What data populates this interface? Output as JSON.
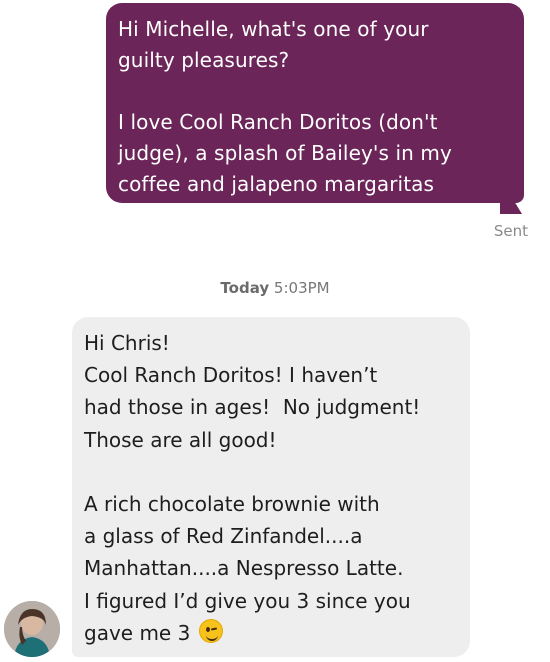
{
  "conversation": {
    "sent_message": {
      "text": "Hi Michelle, what's one of your\nguilty pleasures?\n\nI love Cool Ranch Doritos (don't\njudge), a splash of Bailey's in my\ncoffee and jalapeno margaritas",
      "status": "Sent"
    },
    "timestamp": {
      "day": "Today",
      "time": "5:03PM"
    },
    "received_message": {
      "text": "Hi Chris!\nCool Ranch Doritos! I haven’t\nhad those in ages!  No judgment!\nThose are all good!\n\nA rich chocolate brownie with\na glass of Red Zinfandel....a\nManhattan....a Nespresso Latte.\nI figured I’d give you 3 since you\ngave me 3 ",
      "emoji": "winking-face-emoji"
    },
    "avatar": {
      "icon": "contact-avatar"
    }
  },
  "colors": {
    "sent_bubble": "#6b2558",
    "received_bubble": "#eeeeee",
    "status_text": "#8a8a8a"
  }
}
